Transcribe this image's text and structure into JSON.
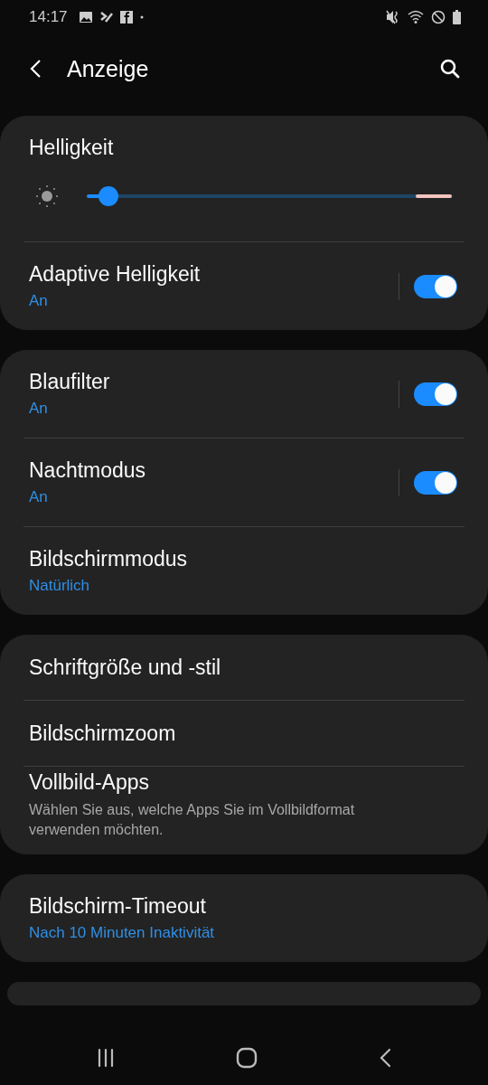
{
  "status_bar": {
    "time": "14:17"
  },
  "header": {
    "title": "Anzeige"
  },
  "groups": [
    {
      "items": [
        {
          "kind": "slider",
          "title": "Helligkeit",
          "level": 0.06
        },
        {
          "kind": "switch",
          "title": "Adaptive Helligkeit",
          "subtitle": "An",
          "on": true
        }
      ]
    },
    {
      "items": [
        {
          "kind": "switch",
          "title": "Blaufilter",
          "subtitle": "An",
          "on": true
        },
        {
          "kind": "switch",
          "title": "Nachtmodus",
          "subtitle": "An",
          "on": true
        },
        {
          "kind": "plain",
          "title": "Bildschirmmodus",
          "subtitle": "Natürlich"
        }
      ]
    },
    {
      "items": [
        {
          "kind": "plain",
          "title": "Schriftgröße und -stil"
        },
        {
          "kind": "plain",
          "title": "Bildschirmzoom"
        },
        {
          "kind": "plain",
          "title": "Vollbild-Apps",
          "description": "Wählen Sie aus, welche Apps Sie im Vollbildformat verwenden möchten."
        }
      ]
    },
    {
      "items": [
        {
          "kind": "plain",
          "title": "Bildschirm-Timeout",
          "subtitle": "Nach 10 Minuten Inaktivität"
        }
      ]
    }
  ]
}
